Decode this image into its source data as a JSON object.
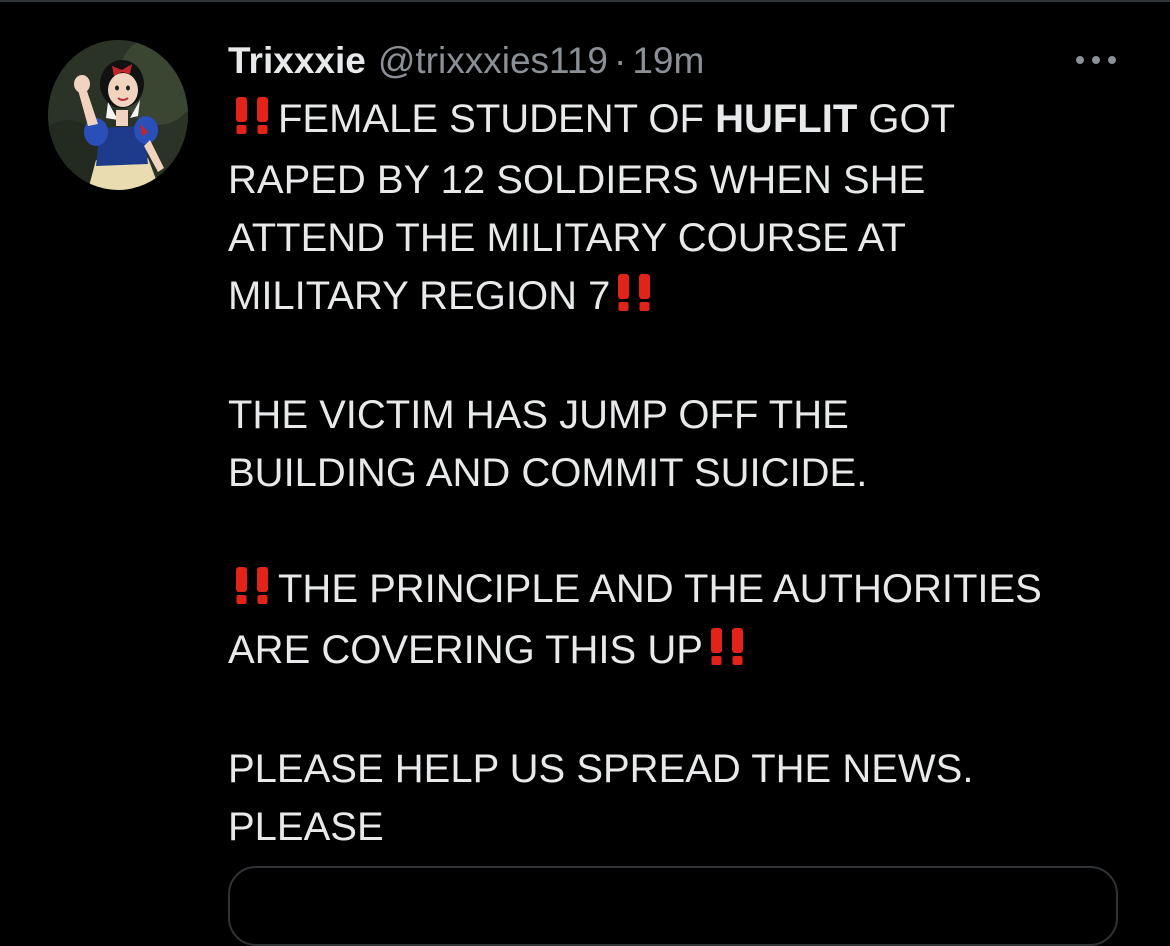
{
  "tweet": {
    "display_name": "Trixxxie",
    "handle": "@trixxxies119",
    "separator": "·",
    "time": "19m",
    "more_icon": "more-horizontal-icon",
    "avatar_icon": "snow-white-avatar",
    "body": {
      "p1_line1_pre": "FEMALE STUDENT OF ",
      "p1_line1_bold": "HUFLIT",
      "p1_line1_post": " GOT",
      "p1_line2": "RAPED BY 12 SOLDIERS WHEN SHE",
      "p1_line3": "ATTEND THE MILITARY COURSE AT",
      "p1_line4": "MILITARY REGION 7",
      "p2_line1": "THE VICTIM HAS JUMP OFF THE",
      "p2_line2": "BUILDING AND COMMIT SUICIDE.",
      "p3_line1": "THE PRINCIPLE AND THE AUTHORITIES",
      "p3_line2": "ARE COVERING THIS UP",
      "p4_line1": "PLEASE HELP US SPREAD THE NEWS.",
      "p4_line2": "PLEASE"
    },
    "colors": {
      "background": "#000000",
      "text": "#e7e9ea",
      "secondary": "#8b9096",
      "emoji_red": "#e2231a",
      "border": "#2f3336"
    }
  }
}
